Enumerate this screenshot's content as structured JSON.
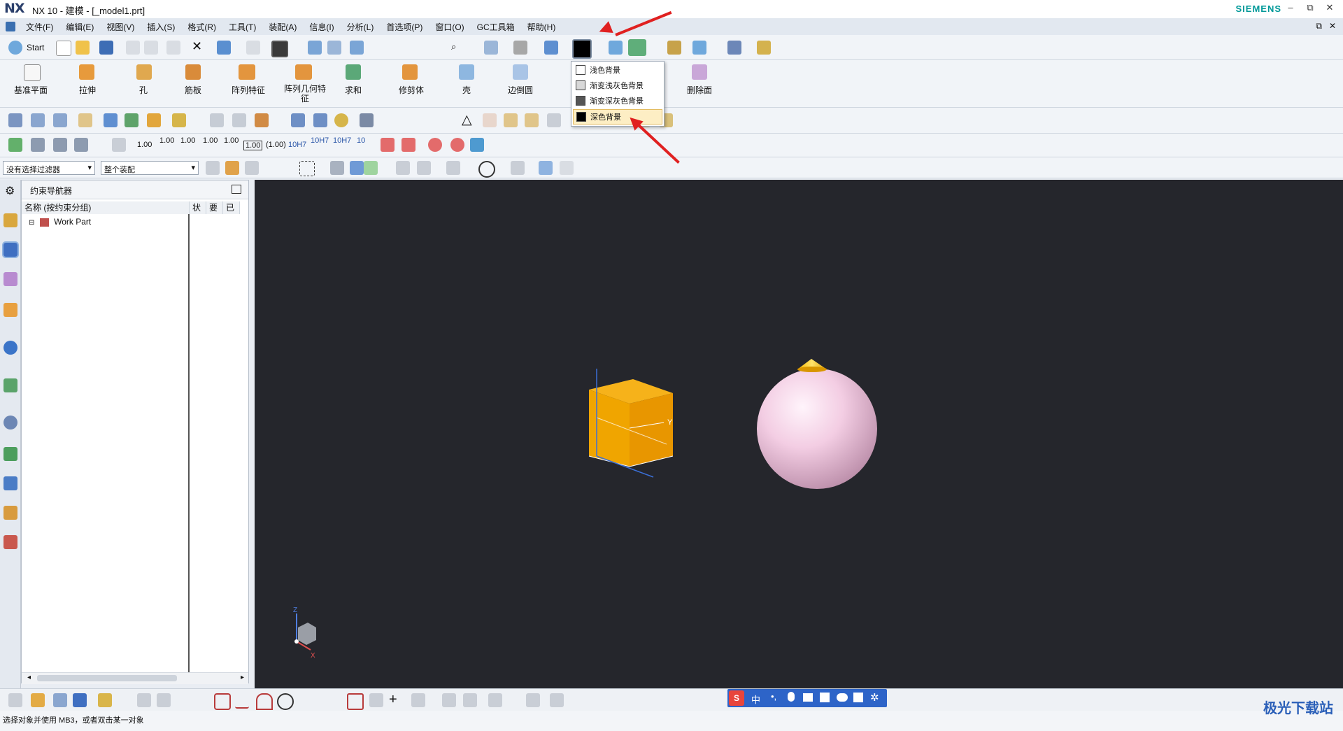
{
  "window": {
    "logo": "NX",
    "title": "NX 10 - 建模 - [_model1.prt]",
    "brand": "SIEMENS",
    "buttons": [
      "–",
      "⧉",
      "✕"
    ]
  },
  "menu": [
    "文件(F)",
    "编辑(E)",
    "视图(V)",
    "插入(S)",
    "格式(R)",
    "工具(T)",
    "装配(A)",
    "信息(I)",
    "分析(L)",
    "首选项(P)",
    "窗口(O)",
    "GC工具箱",
    "帮助(H)"
  ],
  "toolbar": {
    "start_label": "Start",
    "search_placeholder": "查找命令"
  },
  "ribbon": {
    "items": [
      "基准平面",
      "拉伸",
      "孔",
      "筋板",
      "阵列特征",
      "阵列几何特征",
      "求和",
      "修剪体",
      "壳",
      "边倒圆",
      "删除面"
    ]
  },
  "background_menu": {
    "items": [
      "浅色背景",
      "渐变浅灰色背景",
      "渐变深灰色背景",
      "深色背景"
    ],
    "swatches": [
      "#ffffff",
      "#d8d8d8",
      "#555555",
      "#000000"
    ],
    "selected": "深色背景"
  },
  "pmi_labels": [
    "1.00",
    "1.00",
    "1.00",
    "1.00",
    "1.00",
    "1.00",
    "(1.00)",
    "10H7",
    "10H7",
    "10H7",
    "10"
  ],
  "filters": {
    "selection_filter": "没有选择过滤器",
    "assembly_scope": "整个装配"
  },
  "navigator": {
    "title": "约束导航器",
    "columns": [
      "名称 (按约束分组)",
      "状",
      "要",
      "已"
    ],
    "root": "Work Part"
  },
  "viewport": {
    "axis_label": "Y",
    "triad_labels": [
      "Z",
      "X"
    ],
    "colors": {
      "background": "#25262c",
      "cube": "#f0a500",
      "sphere": "#f3cde3",
      "cone": "#f5c400"
    }
  },
  "ime": {
    "label": "中"
  },
  "status_text": "选择对象并使用 MB3，或者双击某一对象",
  "watermark": "极光下载站"
}
